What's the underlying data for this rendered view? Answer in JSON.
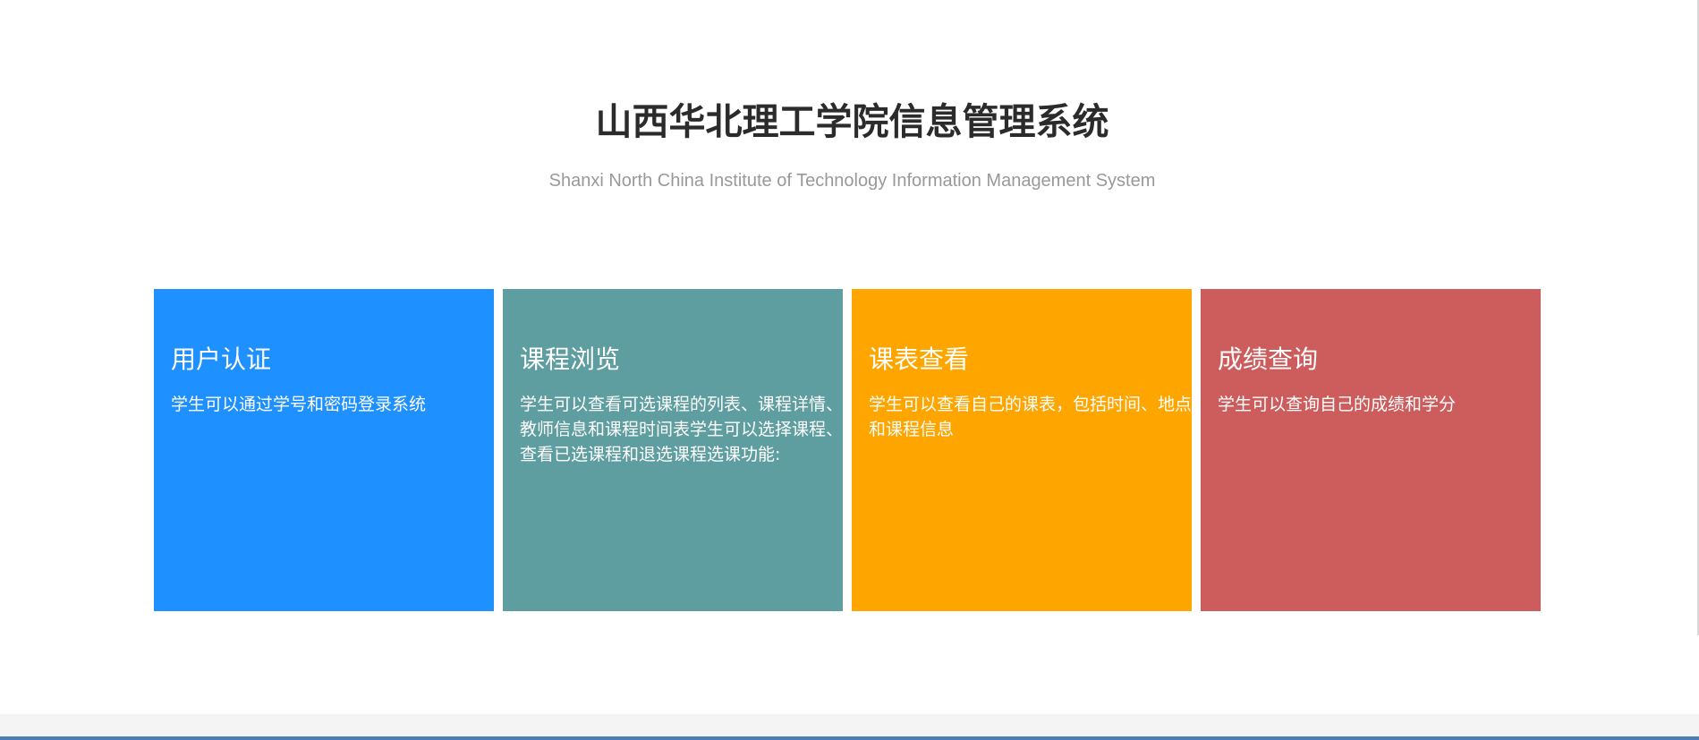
{
  "header": {
    "title": "山西华北理工学院信息管理系统",
    "subtitle": "Shanxi North China Institute of Technology Information Management System"
  },
  "cards": [
    {
      "title": "用户认证",
      "description": "学生可以通过学号和密码登录系统",
      "color": "#1e90ff"
    },
    {
      "title": "课程浏览",
      "description": "学生可以查看可选课程的列表、课程详情、教师信息和课程时间表学生可以选择课程、查看已选课程和退选课程选课功能:",
      "color": "#5f9ea0"
    },
    {
      "title": "课表查看",
      "description": "学生可以查看自己的课表，包括时间、地点和课程信息",
      "color": "#ffa500"
    },
    {
      "title": "成绩查询",
      "description": "学生可以查询自己的成绩和学分",
      "color": "#cd5c5c"
    }
  ],
  "colors": {
    "title_text": "#2b2b2b",
    "subtitle_text": "#999999",
    "footer_background": "#f4f4f4",
    "footer_accent": "#4a7fb5"
  }
}
